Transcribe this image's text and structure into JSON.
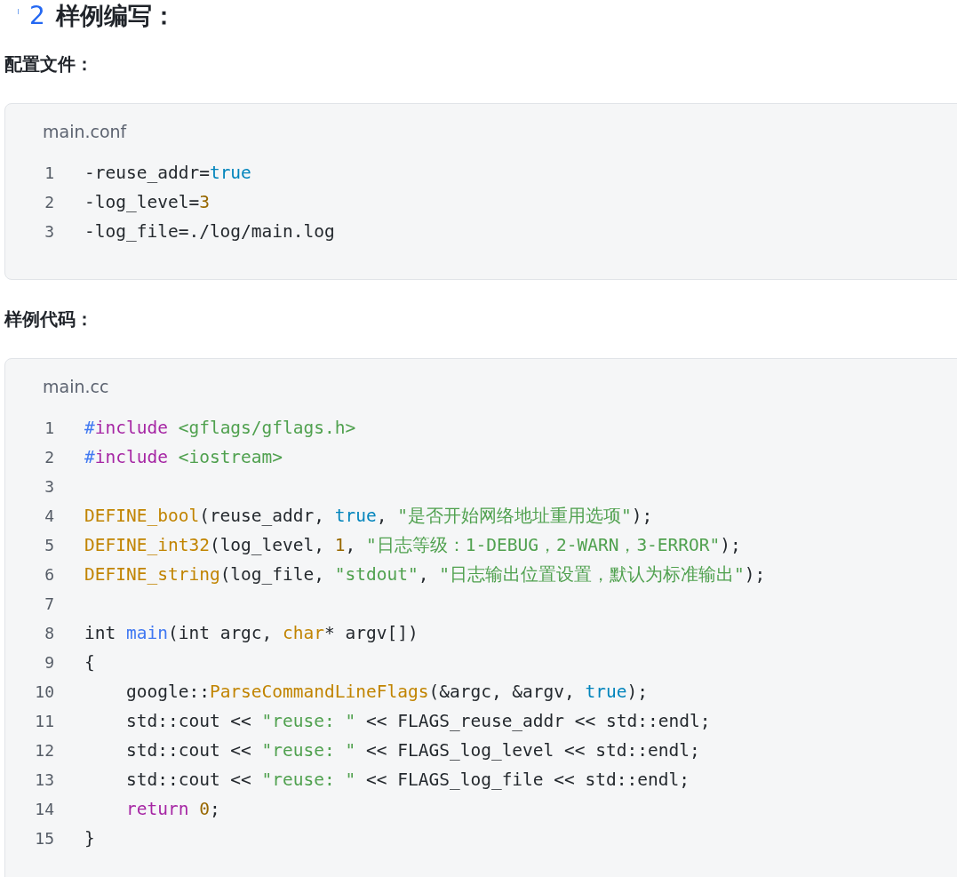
{
  "heading": {
    "number": "2",
    "text": "样例编写："
  },
  "sections": [
    {
      "title": "配置文件：",
      "file": "main.conf",
      "lines": [
        {
          "number": "1",
          "tokens": [
            {
              "kind": "plain",
              "text": "-reuse_addr="
            },
            {
              "kind": "literal",
              "text": "true"
            }
          ]
        },
        {
          "number": "2",
          "tokens": [
            {
              "kind": "plain",
              "text": "-log_level="
            },
            {
              "kind": "number",
              "text": "3"
            }
          ]
        },
        {
          "number": "3",
          "tokens": [
            {
              "kind": "plain",
              "text": "-log_file=./log/main.log"
            }
          ]
        }
      ]
    },
    {
      "title": "样例代码：",
      "file": "main.cc",
      "lines": [
        {
          "number": "1",
          "tokens": [
            {
              "kind": "func",
              "text": "#"
            },
            {
              "kind": "keyword",
              "text": "include "
            },
            {
              "kind": "string",
              "text": "<gflags/gflags.h>"
            }
          ]
        },
        {
          "number": "2",
          "tokens": [
            {
              "kind": "func",
              "text": "#"
            },
            {
              "kind": "keyword",
              "text": "include "
            },
            {
              "kind": "string",
              "text": "<iostream>"
            }
          ]
        },
        {
          "number": "3"
        },
        {
          "number": "4",
          "tokens": [
            {
              "kind": "macro",
              "text": "DEFINE_bool"
            },
            {
              "kind": "plain",
              "text": "(reuse_addr, "
            },
            {
              "kind": "literal",
              "text": "true"
            },
            {
              "kind": "plain",
              "text": ", "
            },
            {
              "kind": "string",
              "text": "\"是否开始网络地址重用选项\""
            },
            {
              "kind": "plain",
              "text": ");"
            }
          ]
        },
        {
          "number": "5",
          "tokens": [
            {
              "kind": "macro",
              "text": "DEFINE_int32"
            },
            {
              "kind": "plain",
              "text": "(log_level, "
            },
            {
              "kind": "number",
              "text": "1"
            },
            {
              "kind": "plain",
              "text": ", "
            },
            {
              "kind": "string",
              "text": "\"日志等级：1-DEBUG，2-WARN，3-ERROR\""
            },
            {
              "kind": "plain",
              "text": ");"
            }
          ]
        },
        {
          "number": "6",
          "tokens": [
            {
              "kind": "macro",
              "text": "DEFINE_string"
            },
            {
              "kind": "plain",
              "text": "(log_file, "
            },
            {
              "kind": "string",
              "text": "\"stdout\""
            },
            {
              "kind": "plain",
              "text": ", "
            },
            {
              "kind": "string",
              "text": "\"日志输出位置设置，默认为标准输出\""
            },
            {
              "kind": "plain",
              "text": ");"
            }
          ]
        },
        {
          "number": "7"
        },
        {
          "number": "8",
          "tokens": [
            {
              "kind": "plain",
              "text": "int "
            },
            {
              "kind": "func",
              "text": "main"
            },
            {
              "kind": "plain",
              "text": "(int argc, "
            },
            {
              "kind": "macro",
              "text": "char"
            },
            {
              "kind": "plain",
              "text": "* argv[])"
            }
          ]
        },
        {
          "number": "9",
          "tokens": [
            {
              "kind": "plain",
              "text": "{"
            }
          ]
        },
        {
          "number": "10",
          "tokens": [
            {
              "kind": "plain",
              "text": "    google::"
            },
            {
              "kind": "macro",
              "text": "ParseCommandLineFlags"
            },
            {
              "kind": "plain",
              "text": "(&argc, &argv, "
            },
            {
              "kind": "literal",
              "text": "true"
            },
            {
              "kind": "plain",
              "text": ");"
            }
          ]
        },
        {
          "number": "11",
          "tokens": [
            {
              "kind": "plain",
              "text": "    std::cout << "
            },
            {
              "kind": "string",
              "text": "\"reuse: \""
            },
            {
              "kind": "plain",
              "text": " << FLAGS_reuse_addr << std::endl;"
            }
          ]
        },
        {
          "number": "12",
          "tokens": [
            {
              "kind": "plain",
              "text": "    std::cout << "
            },
            {
              "kind": "string",
              "text": "\"reuse: \""
            },
            {
              "kind": "plain",
              "text": " << FLAGS_log_level << std::endl;"
            }
          ]
        },
        {
          "number": "13",
          "tokens": [
            {
              "kind": "plain",
              "text": "    std::cout << "
            },
            {
              "kind": "string",
              "text": "\"reuse: \""
            },
            {
              "kind": "plain",
              "text": " << FLAGS_log_file << std::endl;"
            }
          ]
        },
        {
          "number": "14",
          "tokens": [
            {
              "kind": "keyword",
              "text": "    return "
            },
            {
              "kind": "number",
              "text": "0"
            },
            {
              "kind": "plain",
              "text": ";"
            }
          ]
        },
        {
          "number": "15",
          "tokens": [
            {
              "kind": "plain",
              "text": "}"
            }
          ]
        }
      ]
    }
  ]
}
